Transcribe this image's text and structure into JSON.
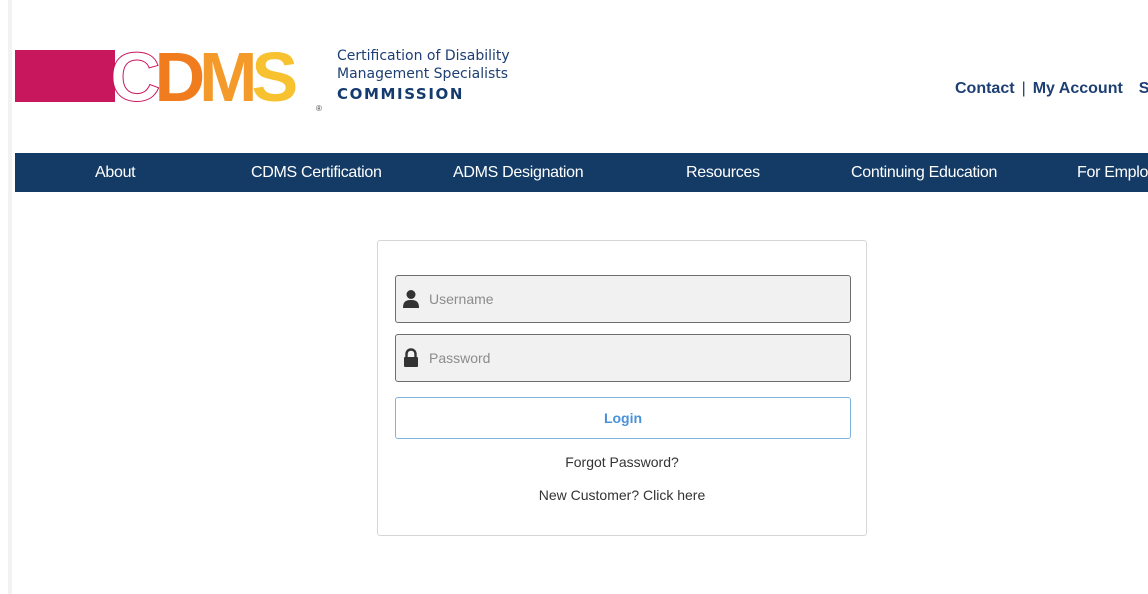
{
  "header": {
    "logo": {
      "letters": [
        {
          "char": "C",
          "color": "#ffffff"
        },
        {
          "char": "D",
          "color": "#f07c1e"
        },
        {
          "char": "M",
          "color": "#f39a2a"
        },
        {
          "char": "S",
          "color": "#f7c12f"
        }
      ],
      "reg_mark": "®",
      "line1": "Certification of Disability",
      "line2": "Management Specialists",
      "line3": "COMMISSION"
    },
    "links": {
      "contact": "Contact",
      "separator": "|",
      "my_account": "My Account",
      "partial": "S"
    }
  },
  "nav": {
    "items": [
      {
        "label": "About"
      },
      {
        "label": "CDMS Certification"
      },
      {
        "label": "ADMS Designation"
      },
      {
        "label": "Resources"
      },
      {
        "label": "Continuing Education"
      },
      {
        "label": "For Emplo"
      }
    ]
  },
  "login": {
    "username": {
      "placeholder": "Username",
      "icon": "user-icon"
    },
    "password": {
      "placeholder": "Password",
      "icon": "lock-icon"
    },
    "login_label": "Login",
    "forgot_label": "Forgot Password?",
    "new_customer_label": "New Customer? Click here"
  },
  "colors": {
    "nav_bg": "#133b66",
    "logo_magenta": "#c8175d",
    "brand_text": "#1d3f73",
    "login_button_text": "#4a90d9"
  }
}
